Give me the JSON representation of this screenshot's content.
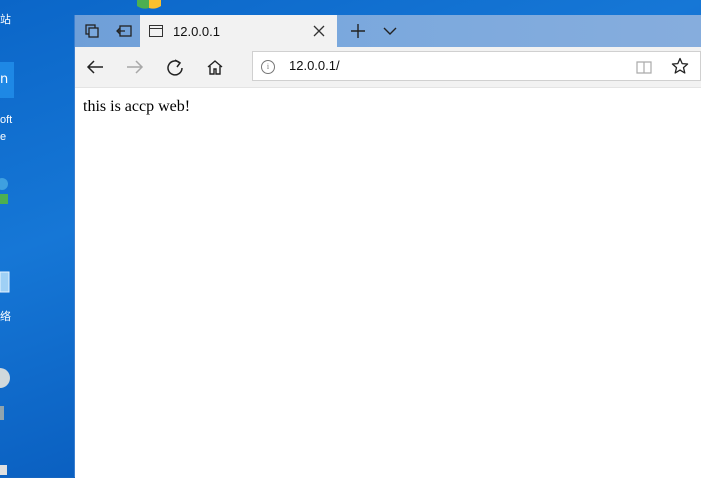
{
  "desktop": {
    "icons": [
      {
        "label": "站",
        "name": "desktop-icon-top"
      },
      {
        "label": "oft",
        "name": "desktop-icon-microsoft"
      },
      {
        "label": "e",
        "name": "desktop-icon-edge"
      },
      {
        "label": "络",
        "name": "desktop-icon-network"
      }
    ]
  },
  "browser": {
    "tab": {
      "title": "12.0.0.1"
    },
    "address": {
      "url": "12.0.0.1/"
    }
  },
  "page": {
    "body_text": "this is accp web!"
  },
  "icons": {
    "tab_actions": "tab-preview-icon",
    "set_aside": "set-aside-tabs-icon",
    "back": "back-arrow-icon",
    "forward": "forward-arrow-icon",
    "refresh": "refresh-icon",
    "home": "home-icon",
    "reading_view": "reading-view-icon",
    "favorite": "star-icon"
  }
}
